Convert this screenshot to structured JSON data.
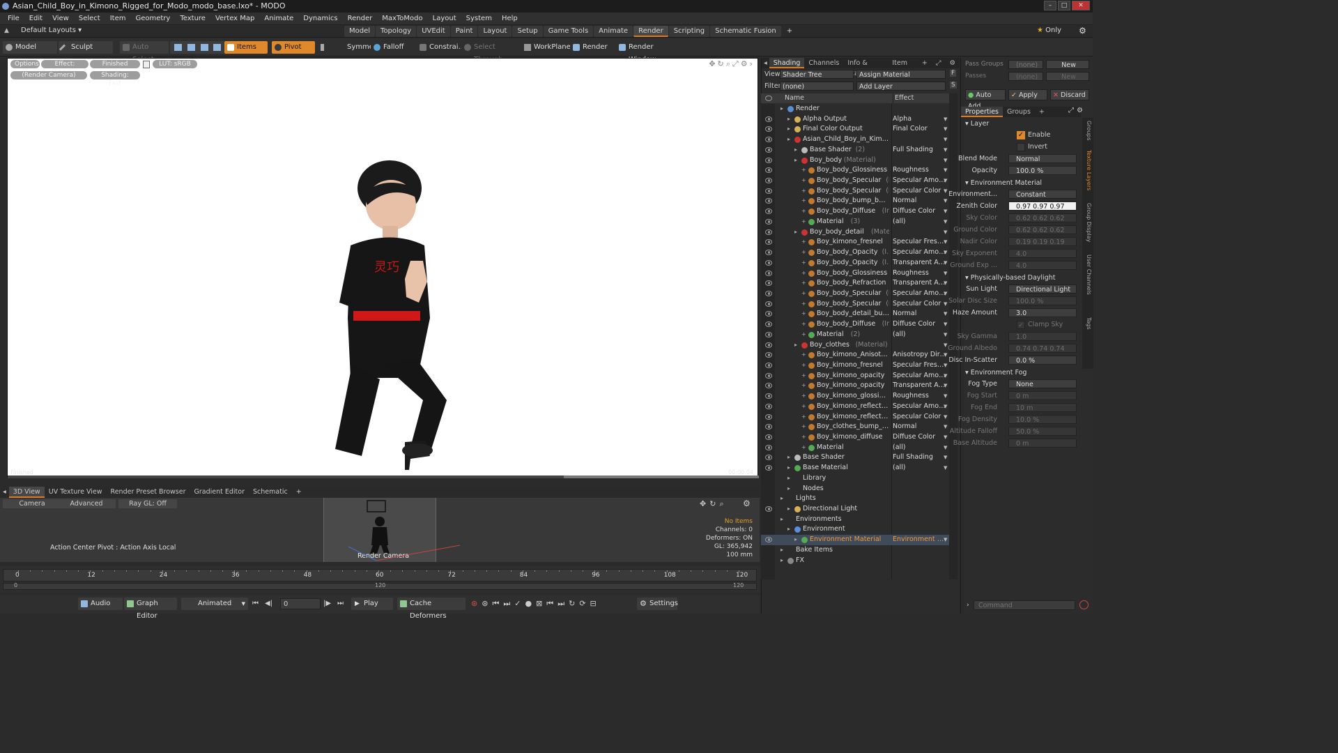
{
  "title": "Asian_Child_Boy_in_Kimono_Rigged_for_Modo_modo_base.lxo* - MODO",
  "menus": [
    "File",
    "Edit",
    "View",
    "Select",
    "Item",
    "Geometry",
    "Texture",
    "Vertex Map",
    "Animate",
    "Dynamics",
    "Render",
    "MaxToModo",
    "Layout",
    "System",
    "Help"
  ],
  "layout_selector": "Default Layouts",
  "layout_tabs": [
    "Model",
    "Topology",
    "UVEdit",
    "Paint",
    "Layout",
    "Setup",
    "Game Tools",
    "Animate",
    "Render",
    "Scripting",
    "Schematic Fusion"
  ],
  "only_label": "Only",
  "toolbar": {
    "model": "Model",
    "sculpt": "Sculpt",
    "auto_select": "Auto Select",
    "items": "Items",
    "pivot": "Pivot",
    "symmetry": "Symmetry",
    "falloff": "Falloff",
    "constrain": "Constrai...",
    "select_through": "Select Through",
    "workplane": "WorkPlane",
    "render": "Render",
    "render_window": "Render Window"
  },
  "viewport_chips": {
    "options": "Options",
    "effect": "Effect: (Shadi...",
    "finished": "Finished",
    "lut": "LUT: sRGB",
    "render_camera": "(Render Camera)",
    "shading": "Shading: Fast"
  },
  "viewport_labels": {
    "left": "Finished",
    "right": "00:00:04"
  },
  "kimono_text": "灵巧",
  "bottom_tabs": [
    "3D View",
    "UV Texture View",
    "Render Preset Browser",
    "Gradient Editor",
    "Schematic"
  ],
  "mini": {
    "camera": "Camera",
    "advanced": "Advanced",
    "raygl": "Ray GL: Off",
    "action_center": "Action Center Pivot : Action Axis Local",
    "render_camera": "Render Camera",
    "stats": [
      "No Items",
      "Channels: 0",
      "Deformers: ON",
      "GL: 365,942",
      "100 mm"
    ]
  },
  "timeline": {
    "ticks": [
      "0",
      "12",
      "24",
      "36",
      "48",
      "60",
      "72",
      "84",
      "96",
      "108",
      "120"
    ],
    "sub_ticks": [
      "0",
      "120",
      "120"
    ]
  },
  "transport": {
    "audio": "Audio",
    "graph_editor": "Graph Editor",
    "animated": "Animated",
    "frame": "0",
    "play": "Play",
    "cache": "Cache Deformers",
    "settings": "Settings"
  },
  "shading_tabs": [
    "Shading",
    "Channels",
    "Info & Statis ...",
    "Item List"
  ],
  "shader_view": {
    "view_label": "View",
    "view_value": "Shader Tree",
    "assign": "Assign Material",
    "filter_label": "Filter",
    "filter_value": "(none)",
    "add_layer": "Add Layer",
    "col_name": "Name",
    "col_effect": "Effect"
  },
  "tree": [
    {
      "indent": 0,
      "eye": false,
      "icon": "#5a8fd6",
      "name": "Render",
      "effect": ""
    },
    {
      "indent": 1,
      "eye": true,
      "icon": "#d7b15a",
      "name": "Alpha Output",
      "effect": "Alpha"
    },
    {
      "indent": 1,
      "eye": true,
      "icon": "#d7b15a",
      "name": "Final Color Output",
      "effect": "Final Color"
    },
    {
      "indent": 1,
      "eye": true,
      "icon": "#cc3333",
      "name": "Asian_Child_Boy_in_Kimono...",
      "effect": ""
    },
    {
      "indent": 2,
      "eye": true,
      "icon": "#bbbbbb",
      "name": "Base Shader",
      "sub": "(2)",
      "effect": "Full Shading"
    },
    {
      "indent": 2,
      "eye": true,
      "icon": "#cc3333",
      "name": "Boy_body",
      "sub": "(Material)",
      "effect": ""
    },
    {
      "indent": 3,
      "eye": true,
      "icon": "#c47a2c",
      "name": "Boy_body_Glossiness",
      "effect": "Roughness"
    },
    {
      "indent": 3,
      "eye": true,
      "icon": "#c47a2c",
      "name": "Boy_body_Specular",
      "sub": "(I...",
      "effect": "Specular Amount"
    },
    {
      "indent": 3,
      "eye": true,
      "icon": "#c47a2c",
      "name": "Boy_body_Specular",
      "sub": "(I...",
      "effect": "Specular Color"
    },
    {
      "indent": 3,
      "eye": true,
      "icon": "#c47a2c",
      "name": "Boy_body_bump_bake...",
      "effect": "Normal"
    },
    {
      "indent": 3,
      "eye": true,
      "icon": "#c47a2c",
      "name": "Boy_body_Diffuse",
      "sub": "(Im...",
      "effect": "Diffuse Color"
    },
    {
      "indent": 3,
      "eye": true,
      "icon": "#55aa55",
      "name": "Material",
      "sub": "(3)",
      "effect": "(all)"
    },
    {
      "indent": 2,
      "eye": true,
      "icon": "#cc3333",
      "name": "Boy_body_detail",
      "sub": "(Material)",
      "effect": ""
    },
    {
      "indent": 3,
      "eye": true,
      "icon": "#c47a2c",
      "name": "Boy_kimono_fresnel",
      "sub": "(I...",
      "effect": "Specular Fresnel"
    },
    {
      "indent": 3,
      "eye": true,
      "icon": "#c47a2c",
      "name": "Boy_body_Opacity",
      "sub": "(I...",
      "effect": "Specular Amount"
    },
    {
      "indent": 3,
      "eye": true,
      "icon": "#c47a2c",
      "name": "Boy_body_Opacity",
      "sub": "(I...",
      "effect": "Transparent Amo ..."
    },
    {
      "indent": 3,
      "eye": true,
      "icon": "#c47a2c",
      "name": "Boy_body_Glossiness",
      "effect": "Roughness"
    },
    {
      "indent": 3,
      "eye": true,
      "icon": "#c47a2c",
      "name": "Boy_body_Refraction",
      "effect": "Transparent Amo ..."
    },
    {
      "indent": 3,
      "eye": true,
      "icon": "#c47a2c",
      "name": "Boy_body_Specular",
      "sub": "(I...",
      "effect": "Specular Amount"
    },
    {
      "indent": 3,
      "eye": true,
      "icon": "#c47a2c",
      "name": "Boy_body_Specular",
      "sub": "(I...",
      "effect": "Specular Color"
    },
    {
      "indent": 3,
      "eye": true,
      "icon": "#c47a2c",
      "name": "Boy_body_detail_bum ...",
      "effect": "Normal"
    },
    {
      "indent": 3,
      "eye": true,
      "icon": "#c47a2c",
      "name": "Boy_body_Diffuse",
      "sub": "(Im...",
      "effect": "Diffuse Color"
    },
    {
      "indent": 3,
      "eye": true,
      "icon": "#55aa55",
      "name": "Material",
      "sub": "(2)",
      "effect": "(all)"
    },
    {
      "indent": 2,
      "eye": true,
      "icon": "#cc3333",
      "name": "Boy_clothes",
      "sub": "(Material)",
      "effect": ""
    },
    {
      "indent": 3,
      "eye": true,
      "icon": "#c47a2c",
      "name": "Boy_kimono_Anisotrop...",
      "effect": "Anisotropy Direct..."
    },
    {
      "indent": 3,
      "eye": true,
      "icon": "#c47a2c",
      "name": "Boy_kimono_fresnel",
      "sub": "(I...",
      "effect": "Specular Fresnel"
    },
    {
      "indent": 3,
      "eye": true,
      "icon": "#c47a2c",
      "name": "Boy_kimono_opacity",
      "sub": "(I...",
      "effect": "Specular Amount"
    },
    {
      "indent": 3,
      "eye": true,
      "icon": "#c47a2c",
      "name": "Boy_kimono_opacity",
      "sub": "(I...",
      "effect": "Transparent Amo ..."
    },
    {
      "indent": 3,
      "eye": true,
      "icon": "#c47a2c",
      "name": "Boy_kimono_glossines ...",
      "effect": "Roughness"
    },
    {
      "indent": 3,
      "eye": true,
      "icon": "#c47a2c",
      "name": "Boy_kimono_reflection ...",
      "effect": "Specular Amount"
    },
    {
      "indent": 3,
      "eye": true,
      "icon": "#c47a2c",
      "name": "Boy_kimono_reflection ...",
      "effect": "Specular Color"
    },
    {
      "indent": 3,
      "eye": true,
      "icon": "#c47a2c",
      "name": "Boy_clothes_bump_ba...",
      "effect": "Normal"
    },
    {
      "indent": 3,
      "eye": true,
      "icon": "#c47a2c",
      "name": "Boy_kimono_diffuse",
      "sub": "(I...",
      "effect": "Diffuse Color"
    },
    {
      "indent": 3,
      "eye": true,
      "icon": "#55aa55",
      "name": "Material",
      "effect": "(all)"
    },
    {
      "indent": 1,
      "eye": true,
      "icon": "#bbbbbb",
      "name": "Base Shader",
      "effect": "Full Shading"
    },
    {
      "indent": 1,
      "eye": true,
      "icon": "#55aa55",
      "name": "Base Material",
      "effect": "(all)"
    },
    {
      "indent": 1,
      "eye": false,
      "icon": "",
      "name": "Library",
      "effect": ""
    },
    {
      "indent": 1,
      "eye": false,
      "icon": "",
      "name": "Nodes",
      "effect": ""
    },
    {
      "indent": 0,
      "eye": false,
      "icon": "",
      "name": "Lights",
      "effect": ""
    },
    {
      "indent": 1,
      "eye": true,
      "icon": "#d7b15a",
      "name": "Directional Light",
      "effect": ""
    },
    {
      "indent": 0,
      "eye": false,
      "icon": "",
      "name": "Environments",
      "effect": ""
    },
    {
      "indent": 1,
      "eye": false,
      "icon": "#5a8fd6",
      "name": "Environment",
      "effect": ""
    },
    {
      "indent": 2,
      "eye": true,
      "icon": "#55aa55",
      "name": "Environment Material",
      "effect": "Environment Color",
      "selected": true
    },
    {
      "indent": 0,
      "eye": false,
      "icon": "",
      "name": "Bake Items",
      "effect": ""
    },
    {
      "indent": 0,
      "eye": false,
      "icon": "#888888",
      "name": "FX",
      "effect": ""
    }
  ],
  "pass": {
    "pass_groups": "Pass Groups",
    "none": "(none)",
    "new": "New",
    "passes": "Passes",
    "auto_add": "Auto Add",
    "apply": "Apply",
    "discard": "Discard"
  },
  "props_tabs": [
    "Properties",
    "Groups"
  ],
  "side_tabs": [
    "Groups",
    "Texture Layers",
    "Group Display",
    "User Channels",
    "Tags"
  ],
  "props": {
    "layer": "Layer",
    "enable": "Enable",
    "invert": "Invert",
    "blend_mode_l": "Blend Mode",
    "blend_mode": "Normal",
    "opacity_l": "Opacity",
    "opacity": "100.0 %",
    "env_material": "Environment Material",
    "environment_l": "Environment...",
    "environment": "Constant",
    "zenith_l": "Zenith Color",
    "zenith": "0.97  0.97  0.97",
    "sky_l": "Sky Color",
    "sky": "0.62  0.62  0.62",
    "ground_l": "Ground Color",
    "ground": "0.62  0.62  0.62",
    "nadir_l": "Nadir Color",
    "nadir": "0.19  0.19  0.19",
    "skyexp_l": "Sky Exponent",
    "skyexp": "4.0",
    "groundexp_l": "Ground Exp ...",
    "groundexp": "4.0",
    "daylight": "Physically-based Daylight",
    "sunlight_l": "Sun Light",
    "sunlight": "Directional Light",
    "solardisc_l": "Solar Disc Size",
    "solardisc": "100.0 %",
    "haze_l": "Haze Amount",
    "haze": "3.0",
    "clamp": "Clamp Sky Brig...",
    "skygamma_l": "Sky Gamma",
    "skygamma": "1.0",
    "albedo_l": "Ground Albedo",
    "albedo": "0.74  0.74  0.74",
    "disc_l": "Disc In-Scatter",
    "disc": "0.0 %",
    "fog": "Environment Fog",
    "fogtype_l": "Fog Type",
    "fogtype": "None",
    "fogstart_l": "Fog Start",
    "fogstart": "0 m",
    "fogend_l": "Fog End",
    "fogend": "10 m",
    "fogdensity_l": "Fog Density",
    "fogdensity": "10.0 %",
    "altfalloff_l": "Altitude Falloff",
    "altfalloff": "50.0 %",
    "basealt_l": "Base Altitude",
    "basealt": "0 m"
  },
  "command_placeholder": "Command",
  "colors": {
    "accent": "#e07a1f",
    "selected_text": "#f19b3b",
    "kimono": "#161616",
    "sash": "#d01818"
  }
}
